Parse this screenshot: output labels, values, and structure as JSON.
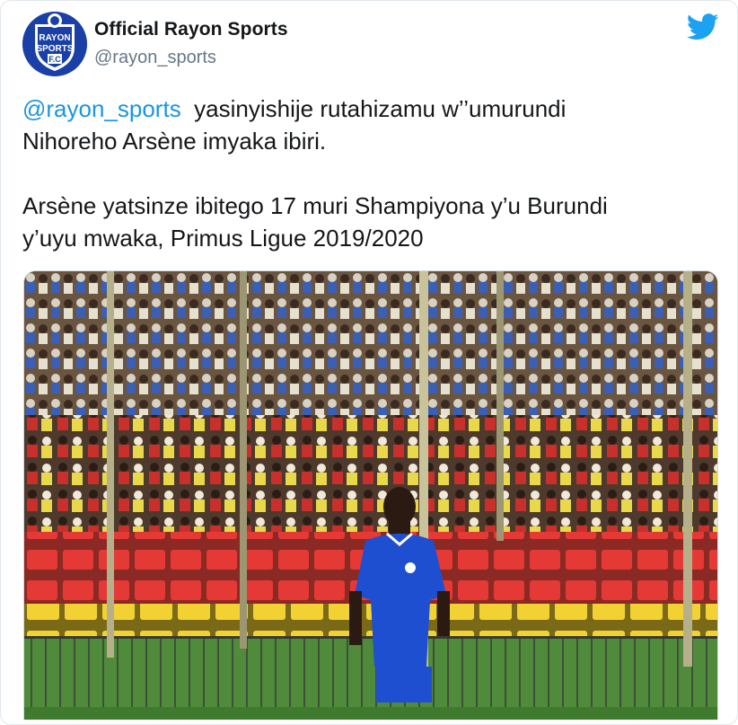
{
  "tweet": {
    "display_name": "Official Rayon Sports",
    "handle": "@rayon_sports",
    "mention": "@rayon_sports",
    "line1_rest": "  yasinyishije rutahizamu w’’umurundi",
    "line2": "Nihoreho Arsène imyaka ibiri.",
    "line3": "Arsène yatsinze ibitego 17 muri Shampiyona y’u Burundi",
    "line4": "y’uyu mwaka, Primus Ligue 2019/2020"
  },
  "avatar": {
    "icon": "rayon-sports-crest",
    "text_top": "RAYON",
    "text_mid": "SPORTS",
    "text_bot": "F.C"
  },
  "icons": {
    "brand": "twitter-bird-icon"
  },
  "colors": {
    "twitter_blue": "#1da1f2",
    "mention_blue": "#1b95e0",
    "crest_blue": "#1a3fa6"
  },
  "media": {
    "kind": "photo"
  }
}
